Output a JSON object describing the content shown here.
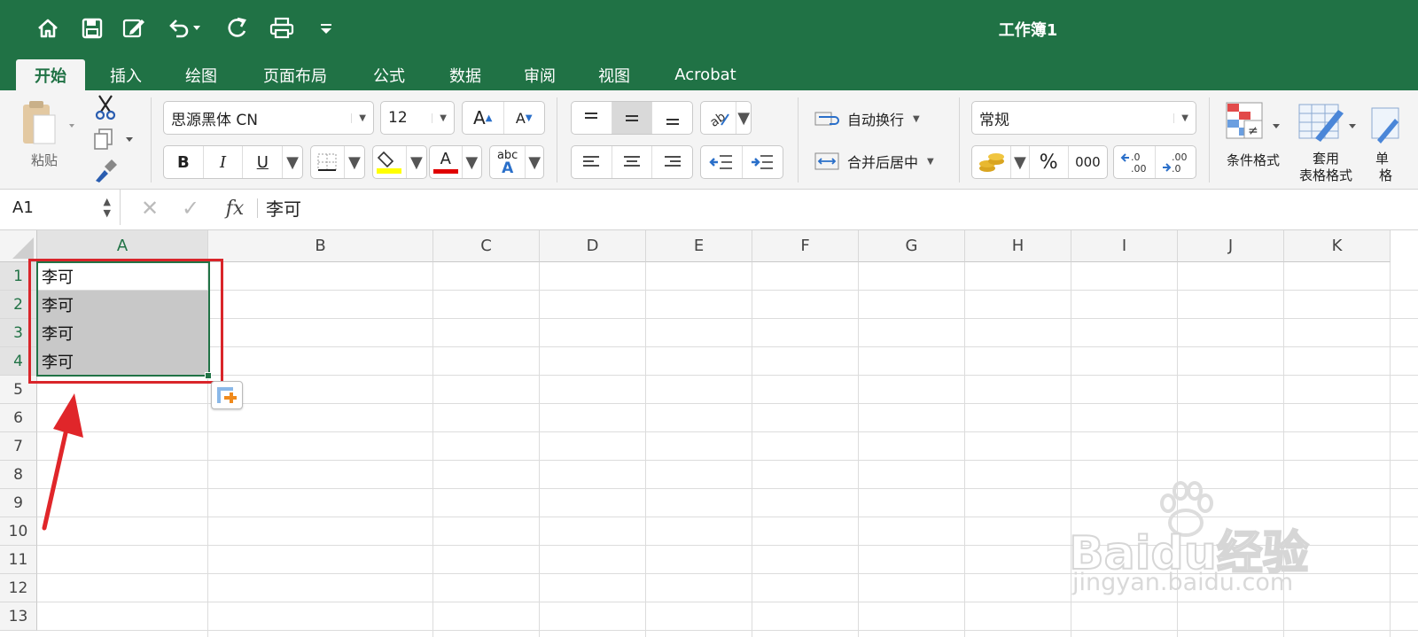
{
  "window": {
    "title": "工作簿1"
  },
  "quick_access": [
    {
      "icon": "home-icon"
    },
    {
      "icon": "save-icon"
    },
    {
      "icon": "edit-icon"
    },
    {
      "icon": "undo-icon"
    },
    {
      "icon": "redo-icon"
    },
    {
      "icon": "print-icon"
    },
    {
      "icon": "customize-icon"
    }
  ],
  "tabs": [
    "开始",
    "插入",
    "绘图",
    "页面布局",
    "公式",
    "数据",
    "审阅",
    "视图",
    "Acrobat"
  ],
  "active_tab": "开始",
  "ribbon": {
    "paste_label": "粘贴",
    "font_name": "思源黑体 CN",
    "font_size": "12",
    "bold": "B",
    "italic": "I",
    "underline": "U",
    "increase_font": "A",
    "decrease_font": "A",
    "font_color_letter": "A",
    "phonetic_top": "abc",
    "phonetic_letter": "A",
    "wrap_text": "自动换行",
    "merge_center": "合并后居中",
    "number_format": "常规",
    "percent": "%",
    "comma": "000",
    "increase_decimal": ".0\n.00",
    "decrease_decimal": ".00\n→.0",
    "conditional_format": "条件格式",
    "format_table_line1": "套用",
    "format_table_line2": "表格格式",
    "cell_styles_cut": "单",
    "cell_styles_cut2": "格",
    "fill_color": "#ffff00",
    "font_color": "#e00000"
  },
  "formula_bar": {
    "name_box": "A1",
    "fx": "fx",
    "content": "李可"
  },
  "sheet": {
    "columns": [
      "A",
      "B",
      "C",
      "D",
      "E",
      "F",
      "G",
      "H",
      "I",
      "J",
      "K"
    ],
    "rows": [
      "1",
      "2",
      "3",
      "4",
      "5",
      "6",
      "7",
      "8",
      "9",
      "10",
      "11",
      "12",
      "13"
    ],
    "cells": {
      "A1": "李可",
      "A2": "李可",
      "A3": "李可",
      "A4": "李可"
    },
    "selection": "A1:A4",
    "highlight_color": "#d9252a",
    "selection_color": "#217346"
  },
  "watermark": {
    "brand": "Baidu经验",
    "url": "jingyan.baidu.com"
  }
}
